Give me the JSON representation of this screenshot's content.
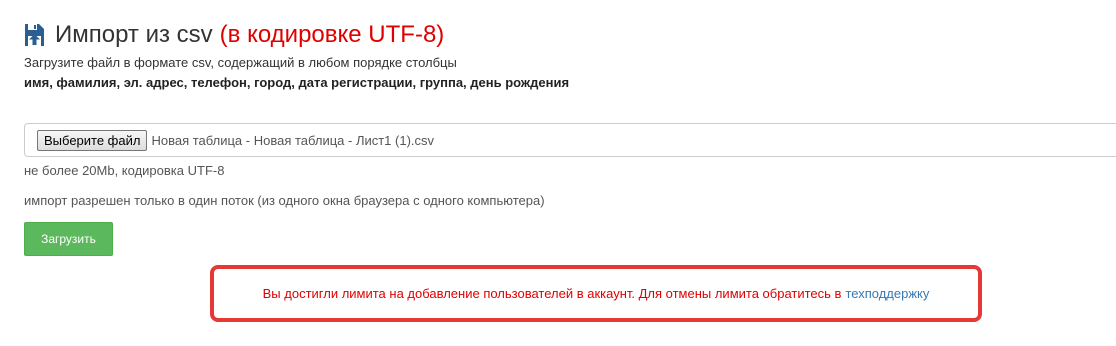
{
  "header": {
    "icon": "file-import-icon",
    "title": "Импорт из csv",
    "title_accent": "(в кодировке UTF-8)",
    "subtitle": "Загрузите файл в формате csv, содержащий в любом порядке столбцы",
    "columns": "имя, фамилия, эл. адрес, телефон, город, дата регистрации, группа, день рождения"
  },
  "file_input": {
    "button_label": "Выберите файл",
    "file_name": "Новая таблица - Новая таблица - Лист1 (1).csv"
  },
  "hints": {
    "size": "не более 20Mb, кодировка UTF-8",
    "stream": "импорт разрешен только в один поток (из одного окна браузера с одного компьютера)"
  },
  "upload_button": {
    "label": "Загрузить"
  },
  "alert": {
    "message": "Вы достигли лимита на добавление пользователей в аккаунт. Для отмены лимита обратитесь в",
    "link_label": "техподдержку"
  },
  "colors": {
    "accent_red": "#e00000",
    "alert_border": "#e53935",
    "success_green": "#5cb85c",
    "link_blue": "#337ab7",
    "icon_blue": "#2b5f93"
  }
}
